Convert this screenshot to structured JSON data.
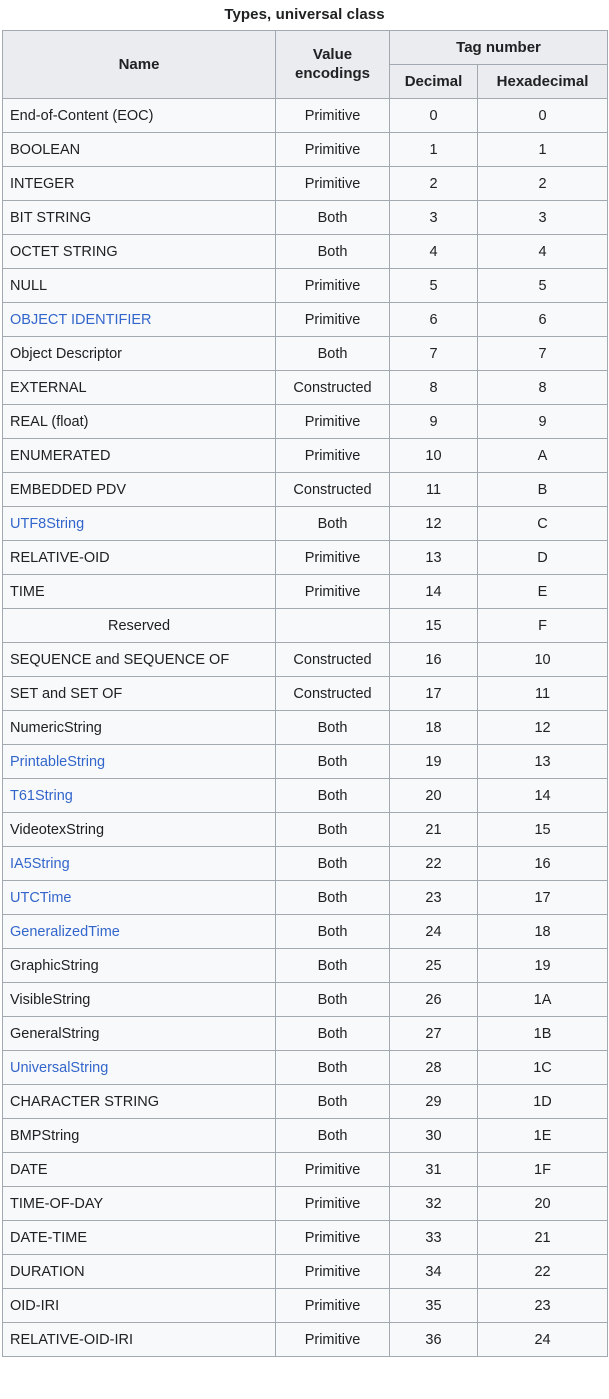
{
  "caption": "Types, universal class",
  "colors": {
    "link": "#3366cc",
    "header_bg": "#eaecf0",
    "cell_bg": "#f8f9fa",
    "reserved_bg": "#eaeaea",
    "border": "#a2a9b1",
    "text": "#202122"
  },
  "headers": {
    "name": "Name",
    "value_encodings": "Value encodings",
    "tag_number": "Tag number",
    "decimal": "Decimal",
    "hexadecimal": "Hexadecimal"
  },
  "rows": [
    {
      "name": "End-of-Content (EOC)",
      "link": false,
      "encoding": "Primitive",
      "decimal": "0",
      "hex": "0"
    },
    {
      "name": "BOOLEAN",
      "link": false,
      "encoding": "Primitive",
      "decimal": "1",
      "hex": "1"
    },
    {
      "name": "INTEGER",
      "link": false,
      "encoding": "Primitive",
      "decimal": "2",
      "hex": "2"
    },
    {
      "name": "BIT STRING",
      "link": false,
      "encoding": "Both",
      "decimal": "3",
      "hex": "3"
    },
    {
      "name": "OCTET STRING",
      "link": false,
      "encoding": "Both",
      "decimal": "4",
      "hex": "4"
    },
    {
      "name": "NULL",
      "link": false,
      "encoding": "Primitive",
      "decimal": "5",
      "hex": "5"
    },
    {
      "name": "OBJECT IDENTIFIER",
      "link": true,
      "encoding": "Primitive",
      "decimal": "6",
      "hex": "6"
    },
    {
      "name": "Object Descriptor",
      "link": false,
      "encoding": "Both",
      "decimal": "7",
      "hex": "7"
    },
    {
      "name": "EXTERNAL",
      "link": false,
      "encoding": "Constructed",
      "decimal": "8",
      "hex": "8"
    },
    {
      "name": "REAL (float)",
      "link": false,
      "encoding": "Primitive",
      "decimal": "9",
      "hex": "9"
    },
    {
      "name": "ENUMERATED",
      "link": false,
      "encoding": "Primitive",
      "decimal": "10",
      "hex": "A"
    },
    {
      "name": "EMBEDDED PDV",
      "link": false,
      "encoding": "Constructed",
      "decimal": "11",
      "hex": "B"
    },
    {
      "name": "UTF8String",
      "link": true,
      "encoding": "Both",
      "decimal": "12",
      "hex": "C"
    },
    {
      "name": "RELATIVE-OID",
      "link": false,
      "encoding": "Primitive",
      "decimal": "13",
      "hex": "D"
    },
    {
      "name": "TIME",
      "link": false,
      "encoding": "Primitive",
      "decimal": "14",
      "hex": "E"
    },
    {
      "name": "Reserved",
      "link": false,
      "encoding": "",
      "decimal": "15",
      "hex": "F",
      "reserved": true
    },
    {
      "name": "SEQUENCE and SEQUENCE OF",
      "link": false,
      "encoding": "Constructed",
      "decimal": "16",
      "hex": "10"
    },
    {
      "name": "SET and SET OF",
      "link": false,
      "encoding": "Constructed",
      "decimal": "17",
      "hex": "11"
    },
    {
      "name": "NumericString",
      "link": false,
      "encoding": "Both",
      "decimal": "18",
      "hex": "12"
    },
    {
      "name": "PrintableString",
      "link": true,
      "encoding": "Both",
      "decimal": "19",
      "hex": "13"
    },
    {
      "name": "T61String",
      "link": true,
      "encoding": "Both",
      "decimal": "20",
      "hex": "14"
    },
    {
      "name": "VideotexString",
      "link": false,
      "encoding": "Both",
      "decimal": "21",
      "hex": "15"
    },
    {
      "name": "IA5String",
      "link": true,
      "encoding": "Both",
      "decimal": "22",
      "hex": "16"
    },
    {
      "name": "UTCTime",
      "link": true,
      "encoding": "Both",
      "decimal": "23",
      "hex": "17"
    },
    {
      "name": "GeneralizedTime",
      "link": true,
      "encoding": "Both",
      "decimal": "24",
      "hex": "18"
    },
    {
      "name": "GraphicString",
      "link": false,
      "encoding": "Both",
      "decimal": "25",
      "hex": "19"
    },
    {
      "name": "VisibleString",
      "link": false,
      "encoding": "Both",
      "decimal": "26",
      "hex": "1A"
    },
    {
      "name": "GeneralString",
      "link": false,
      "encoding": "Both",
      "decimal": "27",
      "hex": "1B"
    },
    {
      "name": "UniversalString",
      "link": true,
      "encoding": "Both",
      "decimal": "28",
      "hex": "1C"
    },
    {
      "name": "CHARACTER STRING",
      "link": false,
      "encoding": "Both",
      "decimal": "29",
      "hex": "1D"
    },
    {
      "name": "BMPString",
      "link": false,
      "encoding": "Both",
      "decimal": "30",
      "hex": "1E"
    },
    {
      "name": "DATE",
      "link": false,
      "encoding": "Primitive",
      "decimal": "31",
      "hex": "1F"
    },
    {
      "name": "TIME-OF-DAY",
      "link": false,
      "encoding": "Primitive",
      "decimal": "32",
      "hex": "20"
    },
    {
      "name": "DATE-TIME",
      "link": false,
      "encoding": "Primitive",
      "decimal": "33",
      "hex": "21"
    },
    {
      "name": "DURATION",
      "link": false,
      "encoding": "Primitive",
      "decimal": "34",
      "hex": "22"
    },
    {
      "name": "OID-IRI",
      "link": false,
      "encoding": "Primitive",
      "decimal": "35",
      "hex": "23"
    },
    {
      "name": "RELATIVE-OID-IRI",
      "link": false,
      "encoding": "Primitive",
      "decimal": "36",
      "hex": "24"
    }
  ]
}
